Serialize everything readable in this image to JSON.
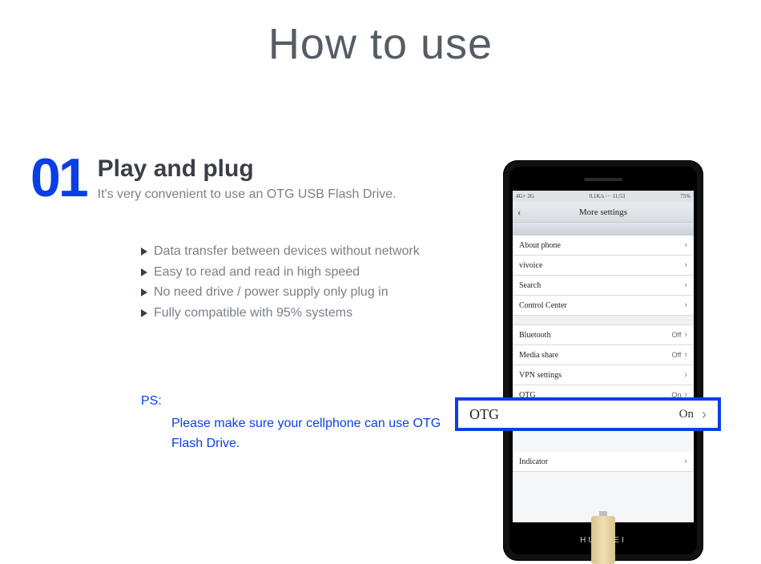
{
  "page": {
    "title": "How to use"
  },
  "step": {
    "number": "01",
    "heading": "Play and plug",
    "sub": "It's very convenient to use an OTG USB Flash Drive."
  },
  "bullets": [
    "Data transfer between devices without network",
    "Easy to read and read in high speed",
    "No need drive / power supply only plug in",
    "Fully compatible with 95% systems"
  ],
  "ps": {
    "label": "PS:",
    "text": "Please make sure your cellphone can use OTG Flash Drive."
  },
  "phone": {
    "status_left": "4G+  2G",
    "status_mid": "0.1K/s ···   11:53",
    "status_right": "75%",
    "header_title": "More settings",
    "brand": "HUAWEI",
    "rows": [
      {
        "label": "About phone",
        "value": ""
      },
      {
        "label": "vivoice",
        "value": ""
      },
      {
        "label": "Search",
        "value": ""
      },
      {
        "label": "Control Center",
        "value": ""
      },
      {
        "label": "Bluetooth",
        "value": "Off"
      },
      {
        "label": "Media share",
        "value": "Off"
      },
      {
        "label": "VPN settings",
        "value": ""
      },
      {
        "label": "OTG",
        "value": "On"
      },
      {
        "label": "Indicator",
        "value": ""
      }
    ]
  },
  "callout": {
    "label": "OTG",
    "value": "On"
  }
}
